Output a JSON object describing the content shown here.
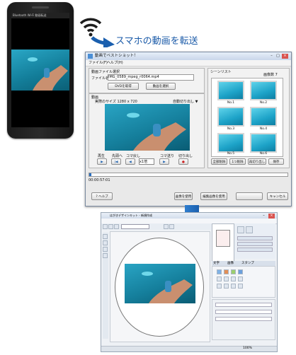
{
  "heading": "スマホの動画を転送",
  "phone": {
    "status_text": "Bluetooth Wi-Fi 動画転送"
  },
  "dialog": {
    "title": "動画でベストショット！",
    "menu": [
      "ファイル(F)",
      "ヘルプ(H)"
    ],
    "file_group_label": "動画ファイル選択",
    "file_label": "ファイル名",
    "file_value": "IMG_0589_mpeg_r0064.mp4",
    "dvd_button": "DVDを取得",
    "select_video_button": "動画を選択",
    "video_group_label": "動画",
    "size_label": "実際のサイズ 1280 x 720",
    "auto_capture": "自動切り出し ▼",
    "scene_list_label": "シーンリスト",
    "image_count": "画像数 7",
    "thumbnails": [
      "No.1",
      "No.2",
      "No.3",
      "No.4",
      "No.5",
      "No.6"
    ],
    "playback_buttons": [
      "再生",
      "先頭へ",
      "コマ戻し",
      "x1倍",
      "コマ送り",
      "切り出し"
    ],
    "speed_select": "x1倍",
    "scene_buttons": [
      "全部削除",
      "1つ削除",
      "再切り出し",
      "保存"
    ],
    "timecode": "00:00:57:01",
    "help_button": "ヘルプ",
    "image_use_button": "画像を使用",
    "edit_button": "編集画像を使用",
    "cancel_button": "キャンセル"
  },
  "editor": {
    "title": "はがきデザインキット - 新規作成",
    "panel_tabs": [
      "文字",
      "画像",
      "スタンプ"
    ],
    "status_text": "100%"
  }
}
